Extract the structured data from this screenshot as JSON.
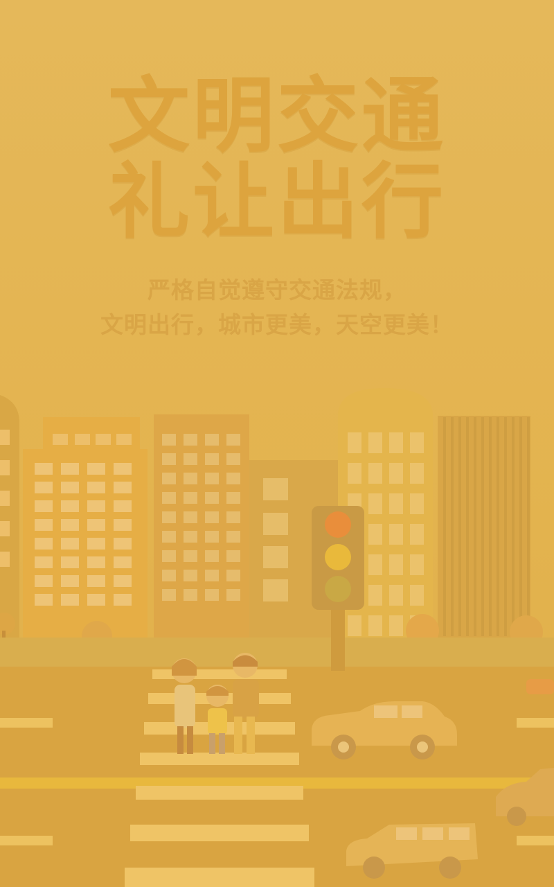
{
  "poster": {
    "title_line1": "文明交通",
    "title_line2": "礼让出行",
    "subtitle_line1": "严格自觉遵守交通法规，",
    "subtitle_line2": "文明出行，城市更美，天空更美！"
  },
  "colors": {
    "background": "#E3B44E",
    "title": "#DDA43E",
    "building_dark": "#D9A53C",
    "road": "#D9A441",
    "stripe": "#EFC466",
    "traffic_light_red": "#E98E3B",
    "traffic_light_yellow": "#E9B93B",
    "traffic_light_green": "#C9A845"
  },
  "illustration": {
    "traffic_light_state": "yellow",
    "pedestrian_count": 3,
    "car_count": 3
  }
}
